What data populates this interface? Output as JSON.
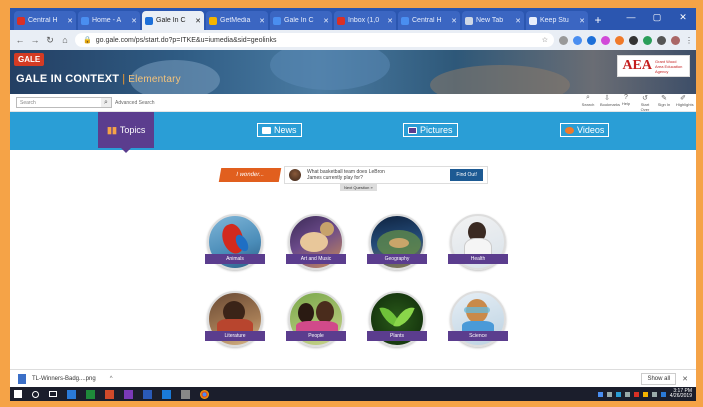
{
  "browser": {
    "tabs": [
      {
        "label": "Central H",
        "color": "#d93025",
        "icon": "gmail-icon"
      },
      {
        "label": "Home - A",
        "color": "#4a8ef0",
        "icon": "edge-icon"
      },
      {
        "label": "Gale In C",
        "color": "#1d6fd8",
        "icon": "gale-icon",
        "active": true
      },
      {
        "label": "GetMedia",
        "color": "#f4b400",
        "icon": "drive-icon"
      },
      {
        "label": "Gale In C",
        "color": "#4a8ef0",
        "icon": "docs-icon"
      },
      {
        "label": "Inbox (1,0",
        "color": "#d93025",
        "icon": "gmail-icon"
      },
      {
        "label": "Central H",
        "color": "#4a8ef0",
        "icon": "calendar-icon"
      },
      {
        "label": "New Tab",
        "color": "#cfd8e6",
        "icon": "newtab-icon"
      },
      {
        "label": "Keep Stu",
        "color": "#e8eefc",
        "icon": "chrome-icon"
      }
    ],
    "new_tab": "+",
    "window_controls": {
      "minimize": "—",
      "maximize": "▢",
      "close": "✕"
    },
    "url": "go.gale.com/ps/start.do?p=ITKE&u=iumedia&sid=geolinks"
  },
  "header": {
    "gale_logo": "GALE",
    "title": "GALE IN CONTEXT",
    "level": "Elementary",
    "aea_logo": "AEA",
    "aea_sub": "Grant Wood Area Education Agency"
  },
  "search": {
    "placeholder": "Search",
    "advanced": "Advanced Search",
    "tools": [
      "Search",
      "Bookmarks",
      "Help",
      "Start Over",
      "Sign In",
      "Highlights"
    ]
  },
  "nav": {
    "items": [
      {
        "label": "Topics",
        "active": true,
        "icon": "topics-icon"
      },
      {
        "label": "News",
        "icon": "news-icon"
      },
      {
        "label": "Pictures",
        "icon": "pictures-icon"
      },
      {
        "label": "Videos",
        "icon": "videos-icon"
      }
    ]
  },
  "wonder": {
    "tag": "I wonder...",
    "question": "What basketball team does LeBron James currently play for?",
    "button": "Find Out!",
    "another": "Next Question »"
  },
  "topics": [
    {
      "label": "Animals"
    },
    {
      "label": "Art and Music"
    },
    {
      "label": "Geography"
    },
    {
      "label": "Health"
    },
    {
      "label": "Literature"
    },
    {
      "label": "People"
    },
    {
      "label": "Plants"
    },
    {
      "label": "Science"
    }
  ],
  "downloads": {
    "file": "TL-Winners-Badg....png",
    "show_all": "Show all",
    "close": "✕"
  },
  "taskbar": {
    "time": "3:17 PM",
    "date": "4/26/2019"
  },
  "colors": {
    "background": "#f5a347",
    "nav": "#2a9ed6",
    "accent_purple": "#5b3d8e",
    "wonder_orange": "#e15f1e"
  }
}
